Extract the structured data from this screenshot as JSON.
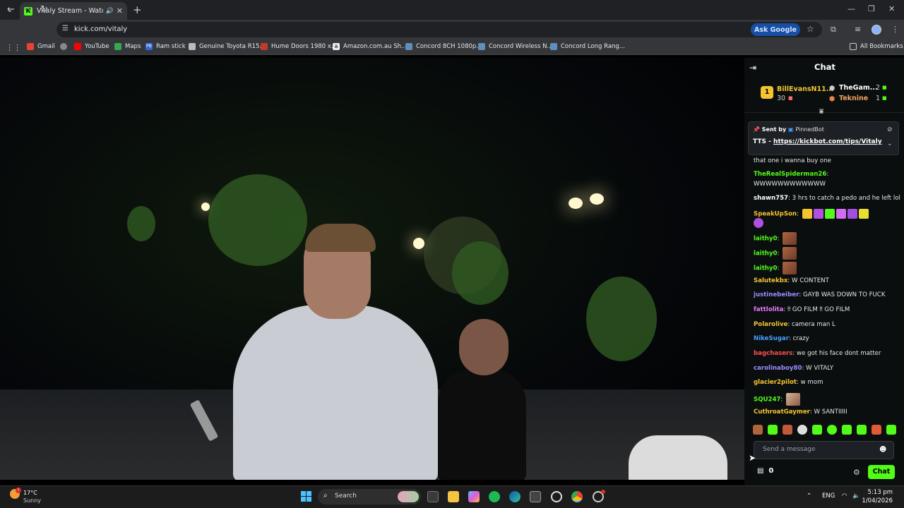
{
  "browser": {
    "tab_title": "Vitaly Stream - Watch Live ...",
    "url": "kick.com/vitaly",
    "ask_google": "Ask Google",
    "bookmarks": [
      "Gmail",
      "YouTube",
      "Maps",
      "Ram stick",
      "Genuine Toyota R15...",
      "Hume Doors 1980 x...",
      "Amazon.com.au Sh...",
      "Concord 8CH 1080p...",
      "Concord Wireless N...",
      "Concord Long Rang..."
    ],
    "all_bookmarks": "All Bookmarks"
  },
  "chat": {
    "title": "Chat",
    "leaderboard": {
      "rank": "1",
      "top": {
        "name": "BillEvansN11...",
        "count": "30"
      },
      "second": {
        "name": "TheGam...",
        "count": "2"
      },
      "third": {
        "name": "Teknine",
        "count": "1"
      }
    },
    "pinned": {
      "sent_by": "Sent by",
      "bot": "PinnedBot",
      "prefix": "TTS - ",
      "link": "https://kickbot.com/tips/Vitaly"
    },
    "messages": [
      {
        "user": "",
        "text": "that one i wanna buy one",
        "color": "#e8e8e8"
      },
      {
        "user": "TheRealSpiderman26",
        "text": ":",
        "color": "#53fc18"
      },
      {
        "user": "",
        "text": "WWWWWWWWWWWW",
        "color": "#e8e8e8"
      },
      {
        "user": "shawn757",
        "text": ": 3 hrs to catch a pedo and he left lol",
        "color": "#ffffff"
      },
      {
        "user": "SpeakUpSon",
        "text": ":",
        "color": "#f4c430"
      },
      {
        "user": "laithy0",
        "text": ":",
        "color": "#53fc18"
      },
      {
        "user": "laithy0",
        "text": ":",
        "color": "#53fc18"
      },
      {
        "user": "laithy0",
        "text": ":",
        "color": "#53fc18"
      },
      {
        "user": "Salutekbx",
        "text": ": W CONTENT",
        "color": "#f4c430"
      },
      {
        "user": "justinebeiber",
        "text": ": GAYB WAS DOWN TO FUCK",
        "color": "#9b8cff"
      },
      {
        "user": "fattlolita",
        "text": ": ‼ GO FILM ‼ GO FILM",
        "color": "#e579f4"
      },
      {
        "user": "Polarolive",
        "text": ": camera man L",
        "color": "#f4c430"
      },
      {
        "user": "NikeSugar",
        "text": ": crazy",
        "color": "#4a9eff"
      },
      {
        "user": "bagchasers",
        "text": ": we got his face dont matter",
        "color": "#ff4f4f"
      },
      {
        "user": "carolinaboy80",
        "text": ": W VITALY",
        "color": "#9b8cff"
      },
      {
        "user": "glacier2pilot",
        "text": ": w mom",
        "color": "#f4c430"
      },
      {
        "user": "SQU247",
        "text": ":",
        "color": "#53fc18"
      },
      {
        "user": "CuthroatGaymer",
        "text": ": W SANTIIIII",
        "color": "#f4c430"
      }
    ],
    "input_placeholder": "Send a message",
    "points": "0",
    "chat_button": "Chat"
  },
  "taskbar": {
    "temp": "17°C",
    "condition": "Sunny",
    "search": "Search",
    "lang": "ENG",
    "time": "5:13 pm",
    "date": "1/04/2026"
  }
}
